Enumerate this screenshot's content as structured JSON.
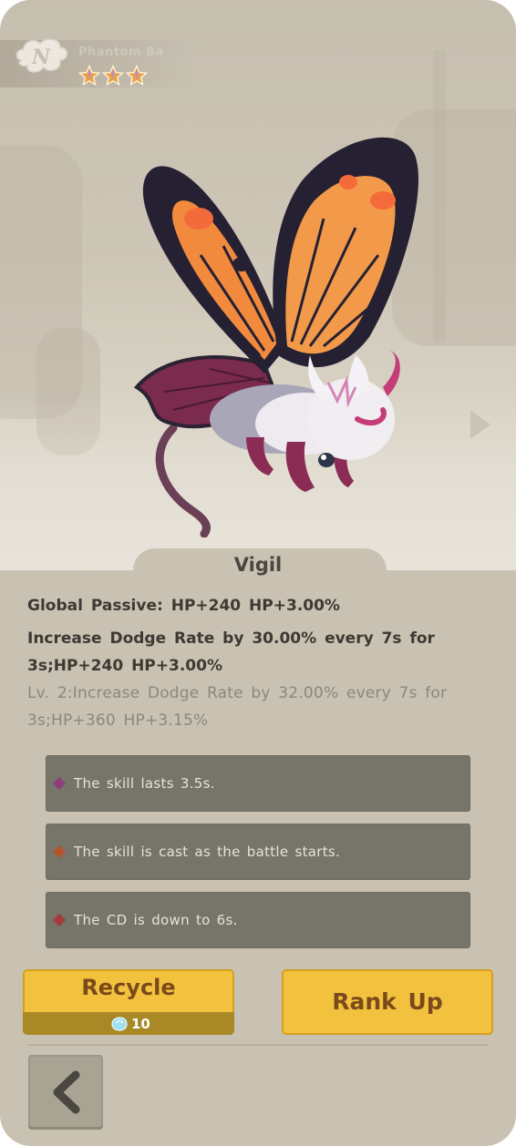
{
  "pet": {
    "rarity_letter": "N",
    "subtitle": "Phantom Ba",
    "star_count": 3,
    "name": "Vigil"
  },
  "description": {
    "passive": "Global Passive: HP+240 HP+3.00%",
    "effect": "Increase Dodge Rate by 30.00% every 7s for 3s;HP+240 HP+3.00%",
    "next_level": "Lv. 2:Increase Dodge Rate by 32.00% every 7s for 3s;HP+360 HP+3.15%"
  },
  "skills": [
    {
      "text": "The skill lasts 3.5s.",
      "gem_color": "#8a3f7a"
    },
    {
      "text": "The skill is cast as the battle starts.",
      "gem_color": "#b3542a"
    },
    {
      "text": "The CD is down to 6s.",
      "gem_color": "#a53a3a"
    }
  ],
  "buttons": {
    "recycle_label": "Recycle",
    "recycle_cost": "10",
    "rank_up_label": "Rank Up"
  },
  "colors": {
    "panel": "#c9c2b2",
    "button_gold": "#f2c23f",
    "button_text": "#7a4a1a",
    "skill_row": "#77756a"
  },
  "icons": [
    "rarity-n-badge-icon",
    "star-icon",
    "next-arrow-icon",
    "crystal-icon",
    "back-arrow-icon"
  ]
}
